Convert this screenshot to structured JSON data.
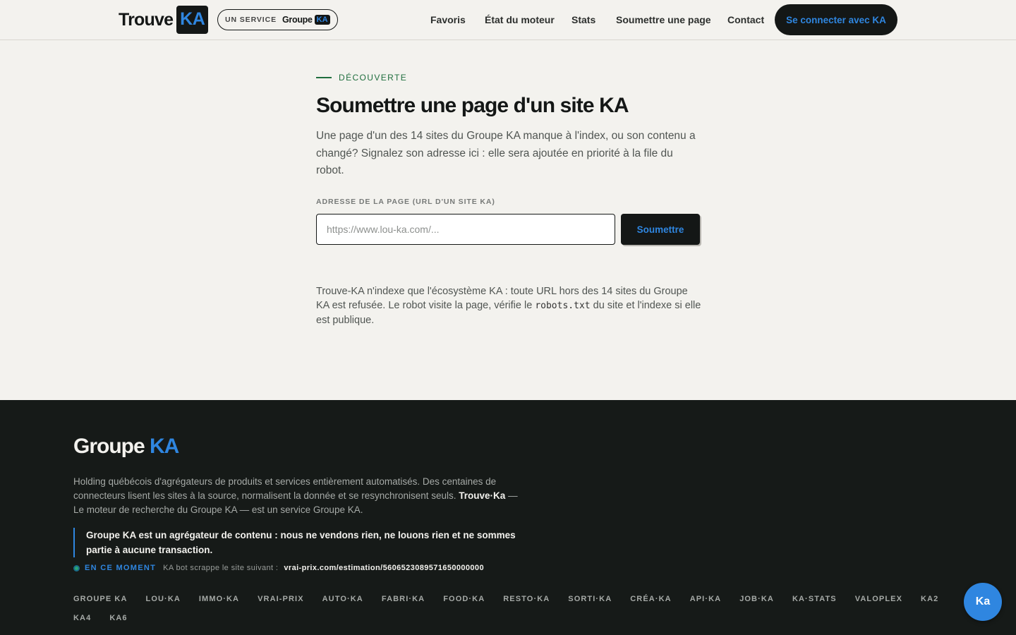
{
  "header": {
    "logo_text": "Trouve",
    "logo_box": "KA",
    "service_label": "UN SERVICE",
    "service_brand": "Groupe",
    "service_box": "KA",
    "nav": [
      "Favoris",
      "État du moteur",
      "Stats",
      "Soumettre une page",
      "Contact"
    ],
    "cta_label": "Se connecter avec KA"
  },
  "main": {
    "eyebrow": "DÉCOUVERTE",
    "title": "Soumettre une page d'un site KA",
    "lead": "Une page d'un des 14 sites du Groupe KA manque à l'index, ou son contenu a changé? Signalez son adresse ici : elle sera ajoutée en priorité à la file du robot.",
    "field_label": "ADRESSE DE LA PAGE (URL D'UN SITE KA)",
    "input_placeholder": "https://www.lou-ka.com/...",
    "input_value": "",
    "submit_label": "Soumettre",
    "note_before": "Trouve-KA n'indexe que l'écosystème KA : toute URL hors des 14 sites du Groupe KA est refusée. Le robot visite la page, vérifie le ",
    "note_code": "robots.txt",
    "note_after": " du site et l'indexe si elle est publique."
  },
  "footer": {
    "logo_main": "Groupe",
    "logo_ka": "KA",
    "desc_before": "Holding québécois d'agrégateurs de produits et services entièrement automatisés. Des centaines de connecteurs lisent les sites à la source, normalisent la donnée et se resynchronisent seuls. ",
    "desc_bold": "Trouve·Ka",
    "desc_after": " — Le moteur de recherche du Groupe KA — est un service Groupe KA.",
    "quote": "Groupe KA est un agrégateur de contenu : nous ne vendons rien, ne louons rien et ne sommes partie à aucune transaction.",
    "now_label": "EN CE MOMENT",
    "now_text": "KA bot scrappe le site suivant :",
    "now_url": "vrai-prix.com/estimation/5606523089571650000000",
    "sites": [
      "GROUPE KA",
      "LOU·KA",
      "IMMO·KA",
      "VRAI-PRIX",
      "AUTO·KA",
      "FABRI·KA",
      "FOOD·KA",
      "RESTO·KA",
      "SORTI·KA",
      "CRÉA·KA",
      "API·KA",
      "JOB·KA",
      "KA·STATS",
      "VALOPLEX",
      "KA2",
      "KA4",
      "KA6"
    ]
  },
  "chat_button": "Ka",
  "colors": {
    "accent": "#2f86e0",
    "dark": "#141716",
    "background": "#f3f2ee",
    "eyebrow": "#1f6e3e"
  }
}
